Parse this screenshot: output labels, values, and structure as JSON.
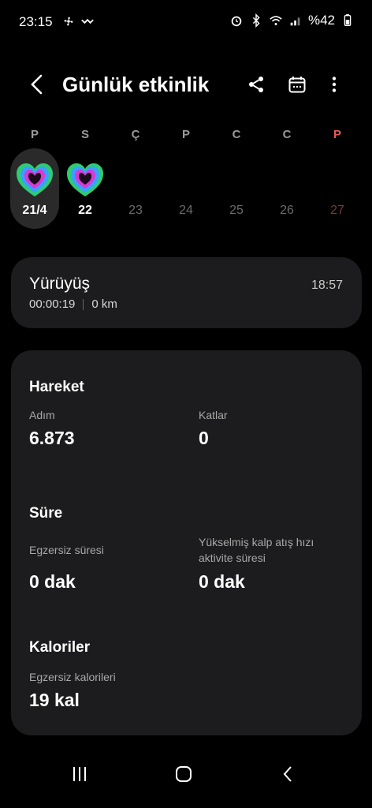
{
  "status_bar": {
    "time": "23:15",
    "battery": "%42",
    "left_icons": [
      "fan-icon",
      "tidal-icon"
    ],
    "right_icons": [
      "alarm-icon",
      "bluetooth-icon",
      "wifi-icon",
      "signal-icon",
      "battery-icon"
    ]
  },
  "header": {
    "title": "Günlük etkinlik",
    "actions": [
      "share-icon",
      "calendar-icon",
      "more-icon"
    ]
  },
  "week": {
    "days": [
      {
        "letter": "P",
        "num": "21/4",
        "has_heart": true,
        "selected": true
      },
      {
        "letter": "S",
        "num": "22",
        "has_heart": true,
        "selected": false
      },
      {
        "letter": "Ç",
        "num": "23",
        "has_heart": false,
        "selected": false
      },
      {
        "letter": "P",
        "num": "24",
        "has_heart": false,
        "selected": false
      },
      {
        "letter": "C",
        "num": "25",
        "has_heart": false,
        "selected": false
      },
      {
        "letter": "C",
        "num": "26",
        "has_heart": false,
        "selected": false
      },
      {
        "letter": "P",
        "num": "27",
        "has_heart": false,
        "selected": false
      }
    ]
  },
  "workout": {
    "title": "Yürüyüş",
    "time": "18:57",
    "duration": "00:00:19",
    "distance": "0 km"
  },
  "movement": {
    "title": "Hareket",
    "steps_label": "Adım",
    "steps_value": "6.873",
    "floors_label": "Katlar",
    "floors_value": "0"
  },
  "duration": {
    "title": "Süre",
    "exercise_label": "Egzersiz süresi",
    "exercise_value": "0 dak",
    "hr_label_line1": "Yükselmiş kalp atış hızı",
    "hr_label_line2": "aktivite süresi",
    "hr_value": "0 dak"
  },
  "calories": {
    "title": "Kaloriler",
    "exercise_label": "Egzersiz kalorileri",
    "exercise_value": "19 kal"
  },
  "colors": {
    "background": "#000000",
    "card": "#1c1c1e",
    "selected_day": "#2a2a2a",
    "heart_outer": "#2ecc71",
    "heart_mid": "#3aa0ff",
    "heart_inner": "#d63ad6",
    "sunday": "#e35b5b"
  }
}
